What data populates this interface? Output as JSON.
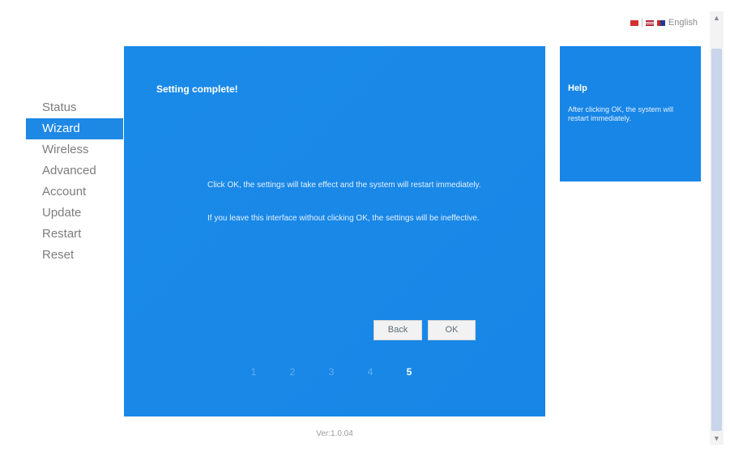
{
  "language_bar": {
    "selected_language": "English",
    "flags": [
      "china-flag",
      "us-flag",
      "uk-flag"
    ]
  },
  "sidebar": {
    "items": [
      {
        "label": "Status",
        "active": false
      },
      {
        "label": "Wizard",
        "active": true
      },
      {
        "label": "Wireless",
        "active": false
      },
      {
        "label": "Advanced",
        "active": false
      },
      {
        "label": "Account",
        "active": false
      },
      {
        "label": "Update",
        "active": false
      },
      {
        "label": "Restart",
        "active": false
      },
      {
        "label": "Reset",
        "active": false
      }
    ]
  },
  "main": {
    "title": "Setting complete!",
    "message_1": "Click OK, the settings will take effect and the system will restart immediately.",
    "message_2": "If you leave this interface without clicking OK, the settings will be ineffective.",
    "back_label": "Back",
    "ok_label": "OK",
    "steps": [
      "1",
      "2",
      "3",
      "4",
      "5"
    ],
    "current_step": 5
  },
  "help": {
    "title": "Help",
    "text": "After clicking OK, the system will restart immediately."
  },
  "footer": {
    "version": "Ver:1.0.04"
  },
  "colors": {
    "panel_blue": "#1886e6",
    "active_nav": "#1e88e5",
    "nav_text": "#7d7d7d"
  }
}
